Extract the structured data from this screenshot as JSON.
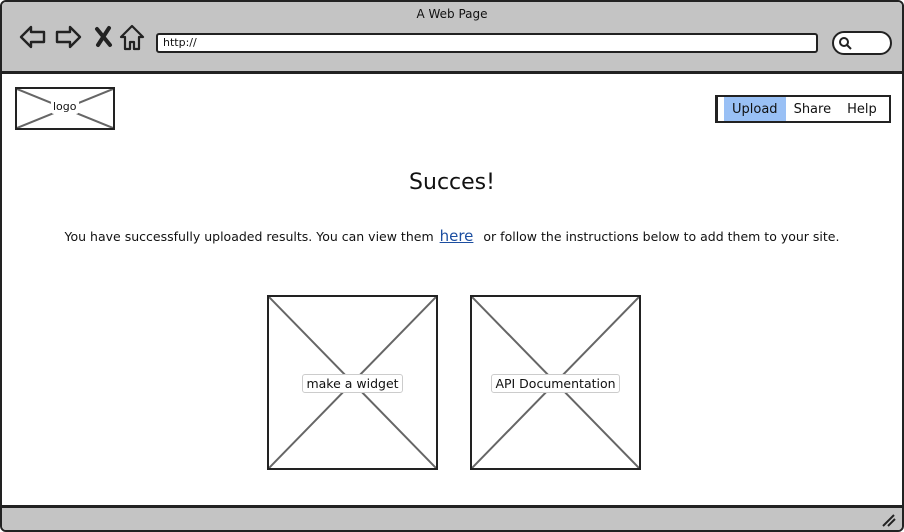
{
  "browser": {
    "title": "A Web Page",
    "url": "http://",
    "icons": [
      "back-arrow-icon",
      "forward-arrow-icon",
      "stop-icon",
      "home-icon",
      "search-icon"
    ]
  },
  "header": {
    "logo_label": "logo",
    "tabs": [
      {
        "label": "Upload",
        "active": true
      },
      {
        "label": "Share",
        "active": false
      },
      {
        "label": "Help",
        "active": false
      }
    ]
  },
  "main": {
    "headline": "Succes!",
    "message_before": "You have successfully uploaded results. You can view them",
    "message_link": "here",
    "message_after": "or follow the instructions below to add them to your site.",
    "cards": [
      {
        "label": "make a widget"
      },
      {
        "label": "API Documentation"
      }
    ]
  },
  "colors": {
    "chrome": "#c4c4c4",
    "active_tab": "#99c0f5",
    "link": "#1c4ea0"
  }
}
